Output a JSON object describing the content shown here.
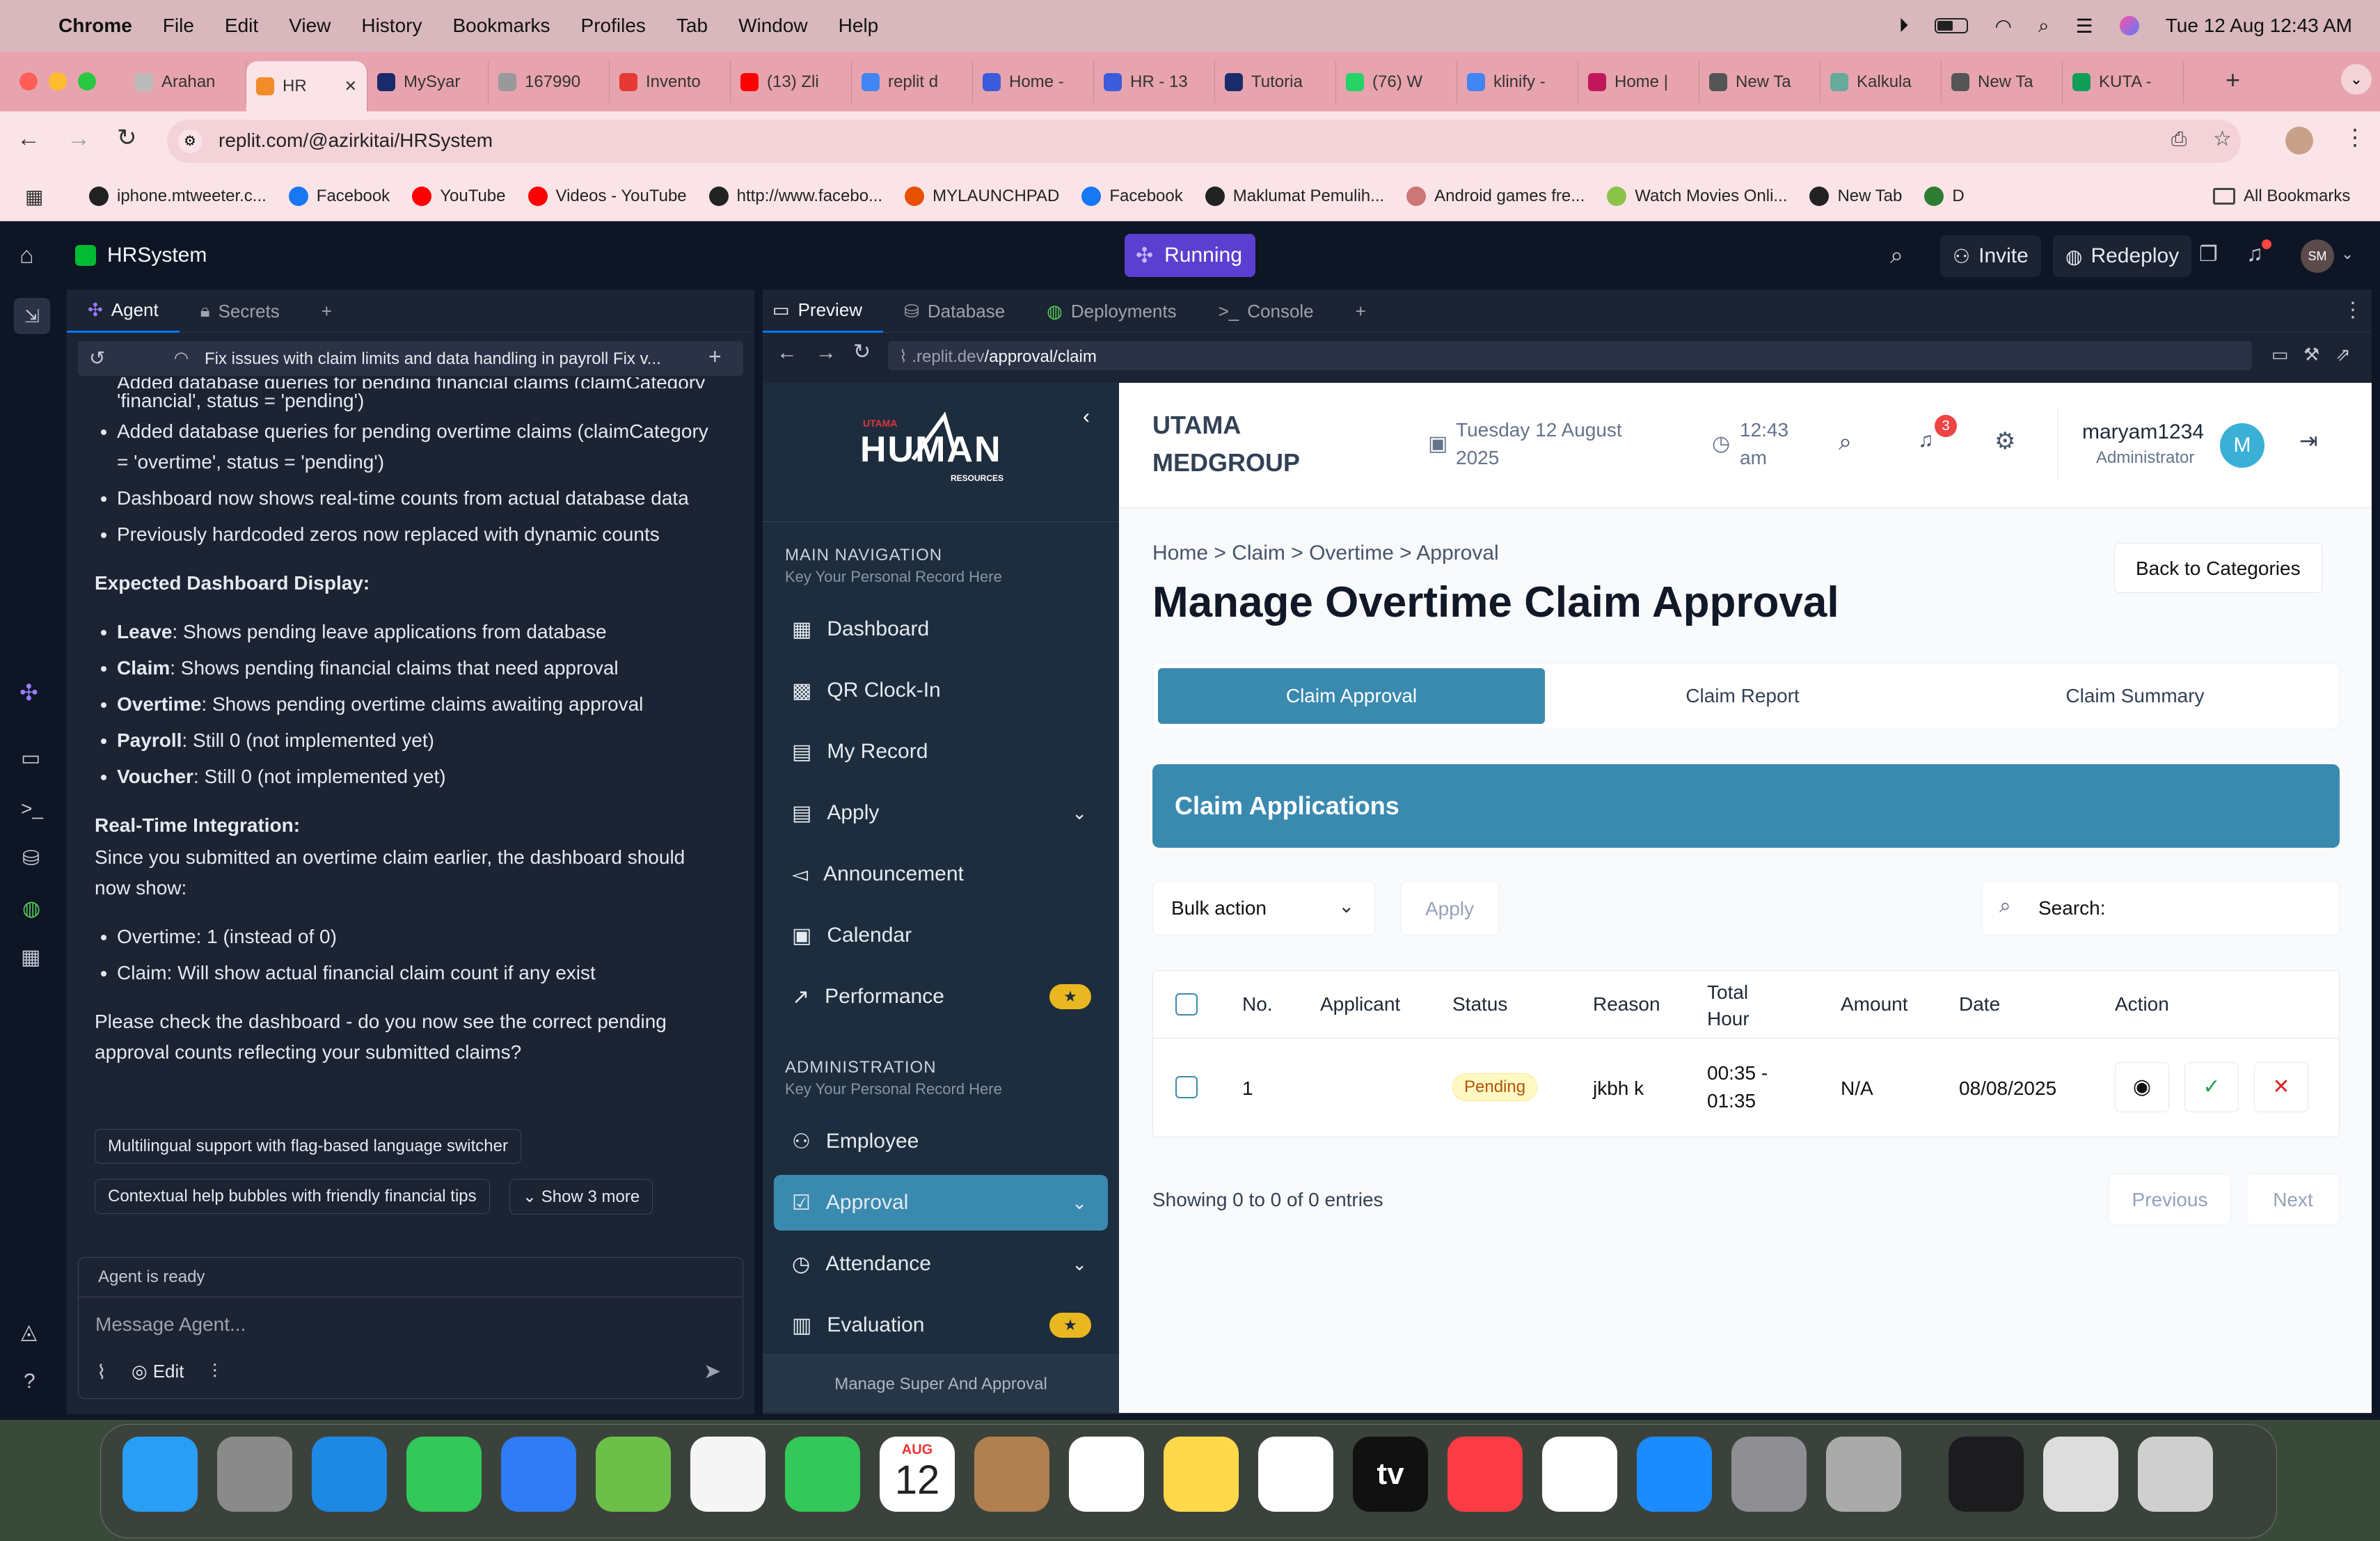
{
  "menubar": {
    "app": "Chrome",
    "items": [
      "File",
      "Edit",
      "View",
      "History",
      "Bookmarks",
      "Profiles",
      "Tab",
      "Window",
      "Help"
    ],
    "datetime": "Tue 12 Aug  12:43 AM"
  },
  "tabs": [
    {
      "label": "Arahan",
      "color": "#bbb"
    },
    {
      "label": "HR",
      "color": "#f28c28",
      "active": true
    },
    {
      "label": "MySyar",
      "color": "#1a2b6b"
    },
    {
      "label": "167990",
      "color": "#999"
    },
    {
      "label": "Invento",
      "color": "#e53935"
    },
    {
      "label": "(13) Zli",
      "color": "#ff0000"
    },
    {
      "label": "replit d",
      "color": "#4285f4"
    },
    {
      "label": "Home -",
      "color": "#3b5bdb"
    },
    {
      "label": "HR - 13",
      "color": "#3b5bdb"
    },
    {
      "label": "Tutoria",
      "color": "#1a2b6b"
    },
    {
      "label": "(76) W",
      "color": "#25d366"
    },
    {
      "label": "klinify -",
      "color": "#4285f4"
    },
    {
      "label": "Home |",
      "color": "#c2185b"
    },
    {
      "label": "New Ta",
      "color": "#555"
    },
    {
      "label": "Kalkula",
      "color": "#6a9"
    },
    {
      "label": "New Ta",
      "color": "#555"
    },
    {
      "label": "KUTA -",
      "color": "#0f9d58"
    }
  ],
  "url": "replit.com/@azirkitai/HRSystem",
  "bookmarks": [
    {
      "label": "iphone.mtweeter.c...",
      "color": "#222"
    },
    {
      "label": "Facebook",
      "color": "#1877f2"
    },
    {
      "label": "YouTube",
      "color": "#ff0000"
    },
    {
      "label": "Videos - YouTube",
      "color": "#ff0000"
    },
    {
      "label": "http://www.facebo...",
      "color": "#222"
    },
    {
      "label": "MYLAUNCHPAD",
      "color": "#e65100"
    },
    {
      "label": "Facebook",
      "color": "#1877f2"
    },
    {
      "label": "Maklumat Pemulih...",
      "color": "#222"
    },
    {
      "label": "Android games fre...",
      "color": "#c77"
    },
    {
      "label": "Watch Movies Onli...",
      "color": "#8bc34a"
    },
    {
      "label": "New Tab",
      "color": "#222"
    },
    {
      "label": "D",
      "color": "#2e7d32"
    }
  ],
  "all_bookmarks": "All Bookmarks",
  "replit": {
    "project": "HRSystem",
    "status": "Running",
    "invite": "Invite",
    "redeploy": "Redeploy",
    "avatar": "SM",
    "left_tabs": [
      "Agent",
      "Secrets"
    ],
    "thread_title": "Fix issues with claim limits and data handling in payroll Fix v...",
    "agent": {
      "cut_line": "Added database queries for pending financial claims (claimCategory =",
      "b1": "'financial', status = 'pending')",
      "b2": "Added database queries for pending overtime claims (claimCategory = 'overtime', status = 'pending')",
      "b3": "Dashboard now shows real-time counts from actual database data",
      "b4": "Previously hardcoded zeros now replaced with dynamic counts",
      "h1": "Expected Dashboard Display:",
      "items": [
        {
          "k": "Leave",
          "v": ": Shows pending leave applications from database"
        },
        {
          "k": "Claim",
          "v": ": Shows pending financial claims that need approval"
        },
        {
          "k": "Overtime",
          "v": ": Shows pending overtime claims awaiting approval"
        },
        {
          "k": "Payroll",
          "v": ": Still 0 (not implemented yet)"
        },
        {
          "k": "Voucher",
          "v": ": Still 0 (not implemented yet)"
        }
      ],
      "h2": "Real-Time Integration:",
      "p1": "Since you submitted an overtime claim earlier, the dashboard should now show:",
      "c1": "Overtime: 1 (instead of 0)",
      "c2": "Claim: Will show actual financial claim count if any exist",
      "p2": "Please check the dashboard - do you now see the correct pending approval counts reflecting your submitted claims?",
      "chip1": "Multilingual support with flag-based language switcher",
      "chip2": "Contextual help bubbles with friendly financial tips",
      "chip3": "Show 3 more",
      "ready": "Agent is ready",
      "placeholder": "Message Agent...",
      "edit": "Edit"
    },
    "preview_tabs": [
      "Preview",
      "Database",
      "Deployments",
      "Console"
    ],
    "preview_url_a": ".replit.dev",
    "preview_url_b": "/approval/claim"
  },
  "app": {
    "logo_small": "UTAMA",
    "logo": "HUMAN",
    "logo_sub": "RESOURCES",
    "main_nav_title": "MAIN NAVIGATION",
    "main_nav_sub": "Key Your Personal Record Here",
    "nav": [
      "Dashboard",
      "QR Clock-In",
      "My Record",
      "Apply",
      "Announcement",
      "Calendar",
      "Performance"
    ],
    "admin_title": "ADMINISTRATION",
    "admin_sub": "Key Your Personal Record Here",
    "admin_nav": [
      "Employee",
      "Approval",
      "Attendance",
      "Evaluation"
    ],
    "footer": "Manage Super And Approval",
    "company1": "UTAMA",
    "company2": "MEDGROUP",
    "date1": "Tuesday 12 August",
    "date2": "2025",
    "time1": "12:43",
    "time2": "am",
    "notif": "3",
    "user": "maryam1234",
    "role": "Administrator",
    "avatar": "M",
    "breadcrumb": "Home > Claim > Overtime > Approval",
    "title": "Manage Overtime Claim Approval",
    "back": "Back to Categories",
    "tabs": [
      "Claim Approval",
      "Claim Report",
      "Claim Summary"
    ],
    "panel": "Claim Applications",
    "bulk": "Bulk action",
    "apply": "Apply",
    "search": "Search:",
    "cols": [
      "No.",
      "Applicant",
      "Status",
      "Reason",
      "Total Hour",
      "Amount",
      "Date",
      "Action"
    ],
    "row": {
      "no": "1",
      "applicant": "",
      "status": "Pending",
      "reason": "jkbh k",
      "hour1": "00:35 -",
      "hour2": "01:35",
      "amount": "N/A",
      "date": "08/08/2025"
    },
    "showing": "Showing 0 to 0 of 0 entries",
    "prev": "Previous",
    "next": "Next"
  },
  "dock": [
    {
      "name": "finder",
      "color": "#2a9df4"
    },
    {
      "name": "launchpad",
      "color": "#8a8a8a"
    },
    {
      "name": "safari",
      "color": "#1e88e5"
    },
    {
      "name": "messages",
      "color": "#34c759"
    },
    {
      "name": "mail",
      "color": "#2f7cf6"
    },
    {
      "name": "maps",
      "color": "#6cc04a"
    },
    {
      "name": "photos",
      "color": "#f5f5f5"
    },
    {
      "name": "facetime",
      "color": "#34c759"
    },
    {
      "name": "calendar",
      "color": "#ffffff",
      "month": "AUG",
      "day": "12"
    },
    {
      "name": "contacts",
      "color": "#b08050"
    },
    {
      "name": "reminders",
      "color": "#ffffff"
    },
    {
      "name": "notes",
      "color": "#ffd94a"
    },
    {
      "name": "freeform",
      "color": "#ffffff"
    },
    {
      "name": "tv",
      "color": "#111111",
      "label": "tv"
    },
    {
      "name": "music",
      "color": "#fc3c44"
    },
    {
      "name": "chrome",
      "color": "#ffffff"
    },
    {
      "name": "app-store",
      "color": "#1a8cff"
    },
    {
      "name": "system-settings",
      "color": "#8e8e93"
    },
    {
      "name": "iphone-mirroring",
      "color": "#aaaaaa"
    },
    {
      "name": "quicktime",
      "color": "#1c1c1e"
    },
    {
      "name": "preview-doc",
      "color": "#dddddd"
    },
    {
      "name": "trash",
      "color": "#cfcfcf"
    }
  ]
}
